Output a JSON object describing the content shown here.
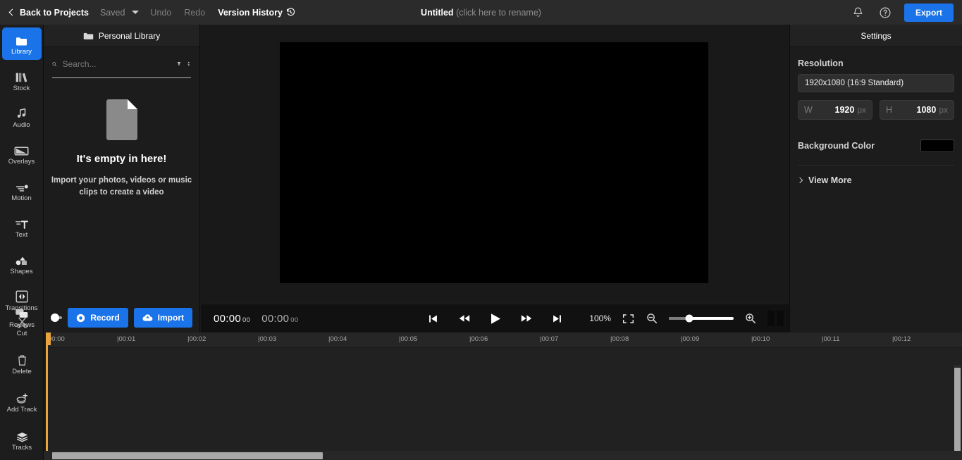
{
  "topbar": {
    "back_label": "Back to Projects",
    "saved_label": "Saved",
    "undo_label": "Undo",
    "redo_label": "Redo",
    "version_history_label": "Version History",
    "project_name": "Untitled",
    "rename_hint": "(click here to rename)",
    "export_label": "Export",
    "accent_color": "#1a73e8"
  },
  "rail": {
    "top_items": [
      {
        "label": "Library",
        "icon": "folder-icon",
        "active": true
      },
      {
        "label": "Stock",
        "icon": "books-icon",
        "active": false
      },
      {
        "label": "Audio",
        "icon": "music-note-icon",
        "active": false
      },
      {
        "label": "Overlays",
        "icon": "overlay-icon",
        "active": false
      },
      {
        "label": "Motion",
        "icon": "motion-icon",
        "active": false
      },
      {
        "label": "Text",
        "icon": "text-icon",
        "active": false
      },
      {
        "label": "Shapes",
        "icon": "shapes-icon",
        "active": false
      },
      {
        "label": "Transitions",
        "icon": "transitions-icon",
        "active": false
      },
      {
        "label": "Reviews",
        "icon": "comments-icon",
        "active": false
      }
    ],
    "bottom_items": [
      {
        "label": "Cut",
        "icon": "scissors-icon"
      },
      {
        "label": "Delete",
        "icon": "trash-icon"
      },
      {
        "label": "Add Track",
        "icon": "add-track-icon"
      },
      {
        "label": "Tracks",
        "icon": "layers-icon"
      }
    ]
  },
  "library": {
    "header_label": "Personal Library",
    "search_placeholder": "Search...",
    "search_value": "",
    "empty_title": "It's empty in here!",
    "empty_subtitle": "Import your photos, videos or music clips to create a video",
    "record_label": "Record",
    "import_label": "Import"
  },
  "player": {
    "current_time": "00:00",
    "current_frames": "00",
    "total_time": "00:00",
    "total_frames": "00",
    "zoom_percent": "100%"
  },
  "settings": {
    "header_label": "Settings",
    "resolution_label": "Resolution",
    "resolution_value": "1920x1080 (16:9 Standard)",
    "width_key": "W",
    "width_value": "1920",
    "width_unit": "px",
    "height_key": "H",
    "height_value": "1080",
    "height_unit": "px",
    "background_color_label": "Background Color",
    "background_color_value": "#000000",
    "view_more_label": "View More"
  },
  "timeline": {
    "ticks": [
      "00:00",
      "00:01",
      "00:02",
      "00:03",
      "00:04",
      "00:05",
      "00:06",
      "00:07",
      "00:08",
      "00:09",
      "00:10",
      "00:11",
      "00:12"
    ],
    "playhead_time": "00:00",
    "playhead_color": "#e8a33d"
  }
}
